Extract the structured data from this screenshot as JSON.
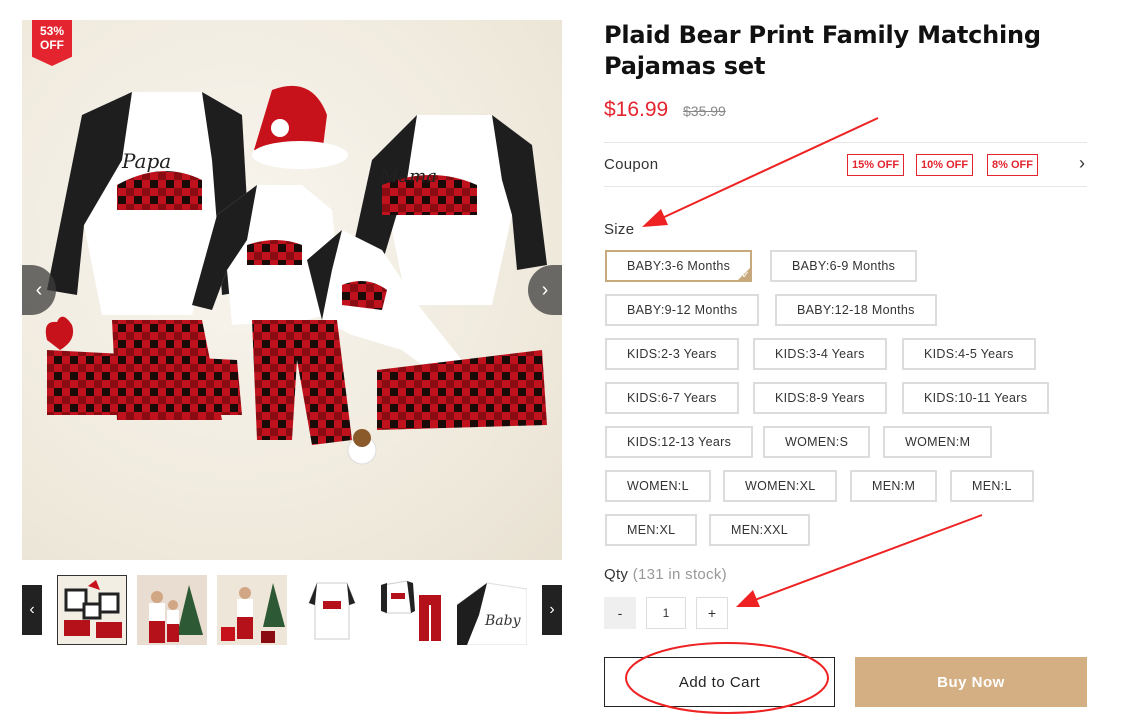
{
  "gallery": {
    "discount_badge": "53% OFF",
    "prev_icon": "chevron-left-icon",
    "next_icon": "chevron-right-icon",
    "thumbnails": [
      "family-pajamas-flatlay",
      "family-by-tree",
      "kids-with-presents",
      "baby-romper",
      "kid-top-and-pants",
      "baby-top-closeup"
    ]
  },
  "product": {
    "title": "Plaid Bear Print Family Matching Pajamas set",
    "price": "$16.99",
    "original_price": "$35.99"
  },
  "coupon": {
    "label": "Coupon",
    "tags": [
      "15% OFF",
      "10% OFF",
      "8% OFF"
    ],
    "chevron_icon": "chevron-right-icon"
  },
  "size": {
    "label": "Size",
    "selected": "BABY:3-6 Months",
    "options": [
      "BABY:3-6 Months",
      "BABY:6-9 Months",
      "BABY:9-12 Months",
      "BABY:12-18 Months",
      "KIDS:2-3 Years",
      "KIDS:3-4 Years",
      "KIDS:4-5 Years",
      "KIDS:6-7 Years",
      "KIDS:8-9 Years",
      "KIDS:10-11 Years",
      "KIDS:12-13 Years",
      "WOMEN:S",
      "WOMEN:M",
      "WOMEN:L",
      "WOMEN:XL",
      "MEN:M",
      "MEN:L",
      "MEN:XL",
      "MEN:XXL"
    ]
  },
  "quantity": {
    "label": "Qty",
    "stock": "(131 in stock)",
    "minus": "-",
    "value": "1",
    "plus": "+"
  },
  "actions": {
    "add_to_cart": "Add to Cart",
    "buy_now": "Buy Now"
  },
  "annotations": {
    "arrow_color": "#ee2222",
    "marks": [
      "arrow-to-size",
      "arrow-to-quantity",
      "circle-around-add-to-cart"
    ]
  },
  "colors": {
    "sale_red": "#e4242f",
    "buy_now_tan": "#d3af83",
    "selected_border": "#c8a97e"
  }
}
